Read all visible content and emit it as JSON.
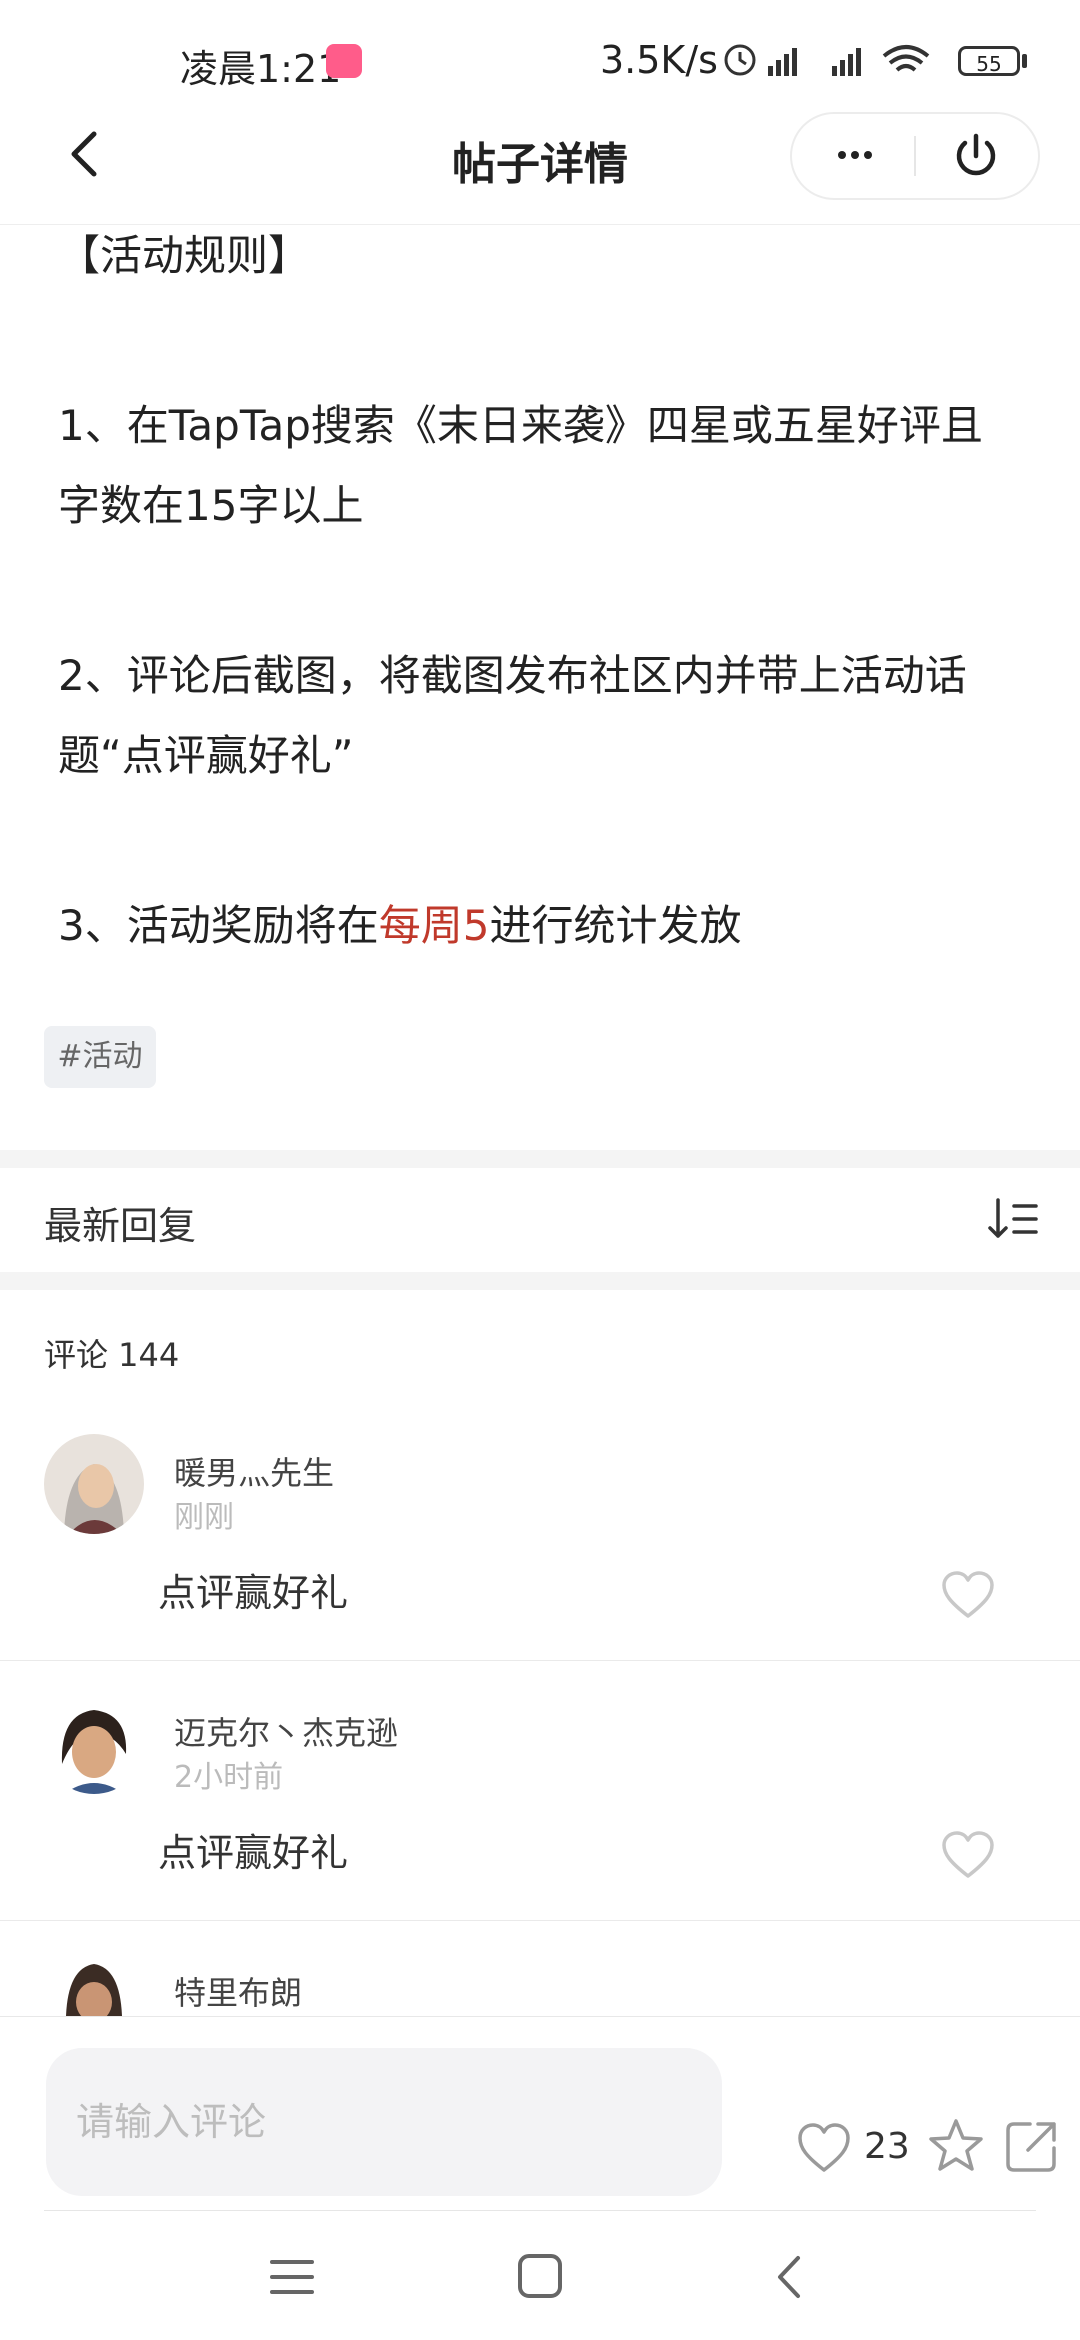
{
  "status_bar": {
    "time": "凌晨1:21",
    "net_speed": "3.5K/s",
    "battery": "55"
  },
  "header": {
    "title": "帖子详情",
    "icons": [
      "back-icon",
      "more-icon",
      "power-icon"
    ]
  },
  "post": {
    "lines": [
      "【活动规则】",
      "1、在TapTap搜索《末日来袭》四星或五星好评且",
      "字数在15字以上",
      "2、评论后截图，将截图发布社区内并带上活动话",
      "题“点评赢好礼”"
    ],
    "line3_prefix": "3、活动奖励将在",
    "line3_highlight": "每周5",
    "line3_suffix": "进行统计发放",
    "highlight_color": "#c0392b",
    "tag": "#活动"
  },
  "replies": {
    "title": "最新回复",
    "comment_count": "评论 144",
    "comments": [
      {
        "user": "暖男灬先生",
        "time": "刚刚",
        "text": "点评赢好礼"
      },
      {
        "user": "迈克尔丶杰克逊",
        "time": "2小时前",
        "text": "点评赢好礼"
      },
      {
        "user": "特里布朗"
      }
    ]
  },
  "bottom_bar": {
    "input_placeholder": "请输入评论",
    "like_count": "23"
  },
  "nav_bar": {
    "icons": [
      "menu-icon",
      "home-icon",
      "back-icon"
    ]
  }
}
